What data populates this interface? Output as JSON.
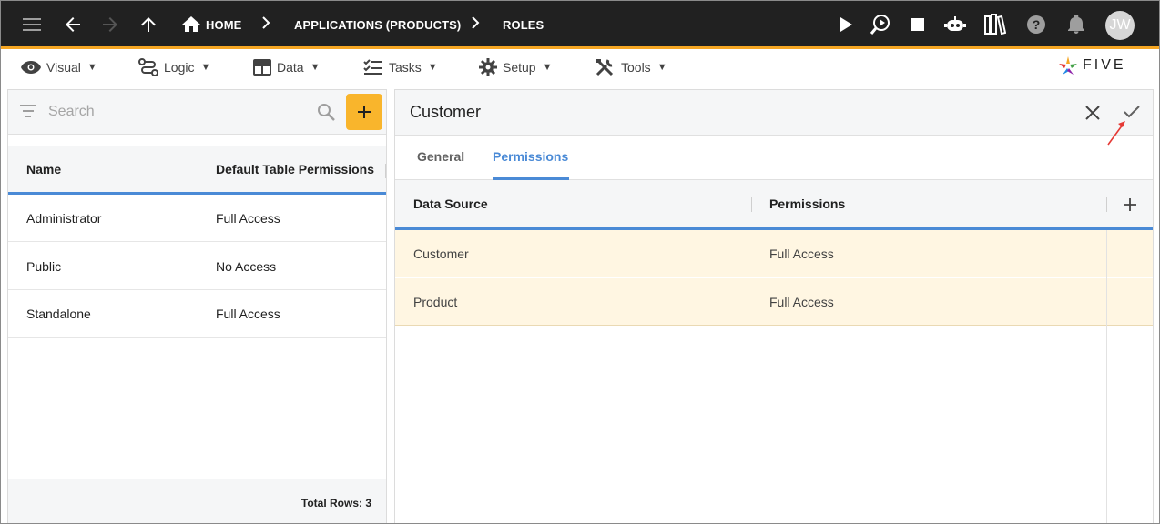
{
  "topbar": {
    "breadcrumbs": [
      "HOME",
      "APPLICATIONS (PRODUCTS)",
      "ROLES"
    ],
    "user_initials": "JW",
    "icons": [
      "menu-icon",
      "back-arrow-icon",
      "forward-arrow-icon",
      "up-arrow-icon",
      "home-icon",
      "play-icon",
      "debug-search-icon",
      "stop-icon",
      "chatbot-icon",
      "library-icon",
      "help-icon",
      "notifications-icon"
    ]
  },
  "menubar": {
    "items": [
      {
        "label": "Visual",
        "icon": "eye-icon"
      },
      {
        "label": "Logic",
        "icon": "logic-icon"
      },
      {
        "label": "Data",
        "icon": "table-icon"
      },
      {
        "label": "Tasks",
        "icon": "tasks-icon"
      },
      {
        "label": "Setup",
        "icon": "gear-icon"
      },
      {
        "label": "Tools",
        "icon": "tools-icon"
      }
    ],
    "caret": "▼",
    "brand": "FIVE"
  },
  "left_panel": {
    "search_placeholder": "Search",
    "columns": [
      "Name",
      "Default Table Permissions"
    ],
    "rows": [
      [
        "Administrator",
        "Full Access"
      ],
      [
        "Public",
        "No Access"
      ],
      [
        "Standalone",
        "Full Access"
      ]
    ],
    "total_rows_label": "Total Rows: 3"
  },
  "right_panel": {
    "title": "Customer",
    "tabs": [
      "General",
      "Permissions"
    ],
    "active_tab": "Permissions",
    "columns": [
      "Data Source",
      "Permissions"
    ],
    "rows": [
      [
        "Customer",
        "Full Access"
      ],
      [
        "Product",
        "Full Access"
      ]
    ]
  },
  "colors": {
    "topbar_bg": "#212121",
    "accent_orange": "#f5a623",
    "add_button": "#f9b52c",
    "active_blue": "#4a8ad6",
    "row_highlight": "#fff6e2",
    "annotation_arrow": "#e53935"
  }
}
